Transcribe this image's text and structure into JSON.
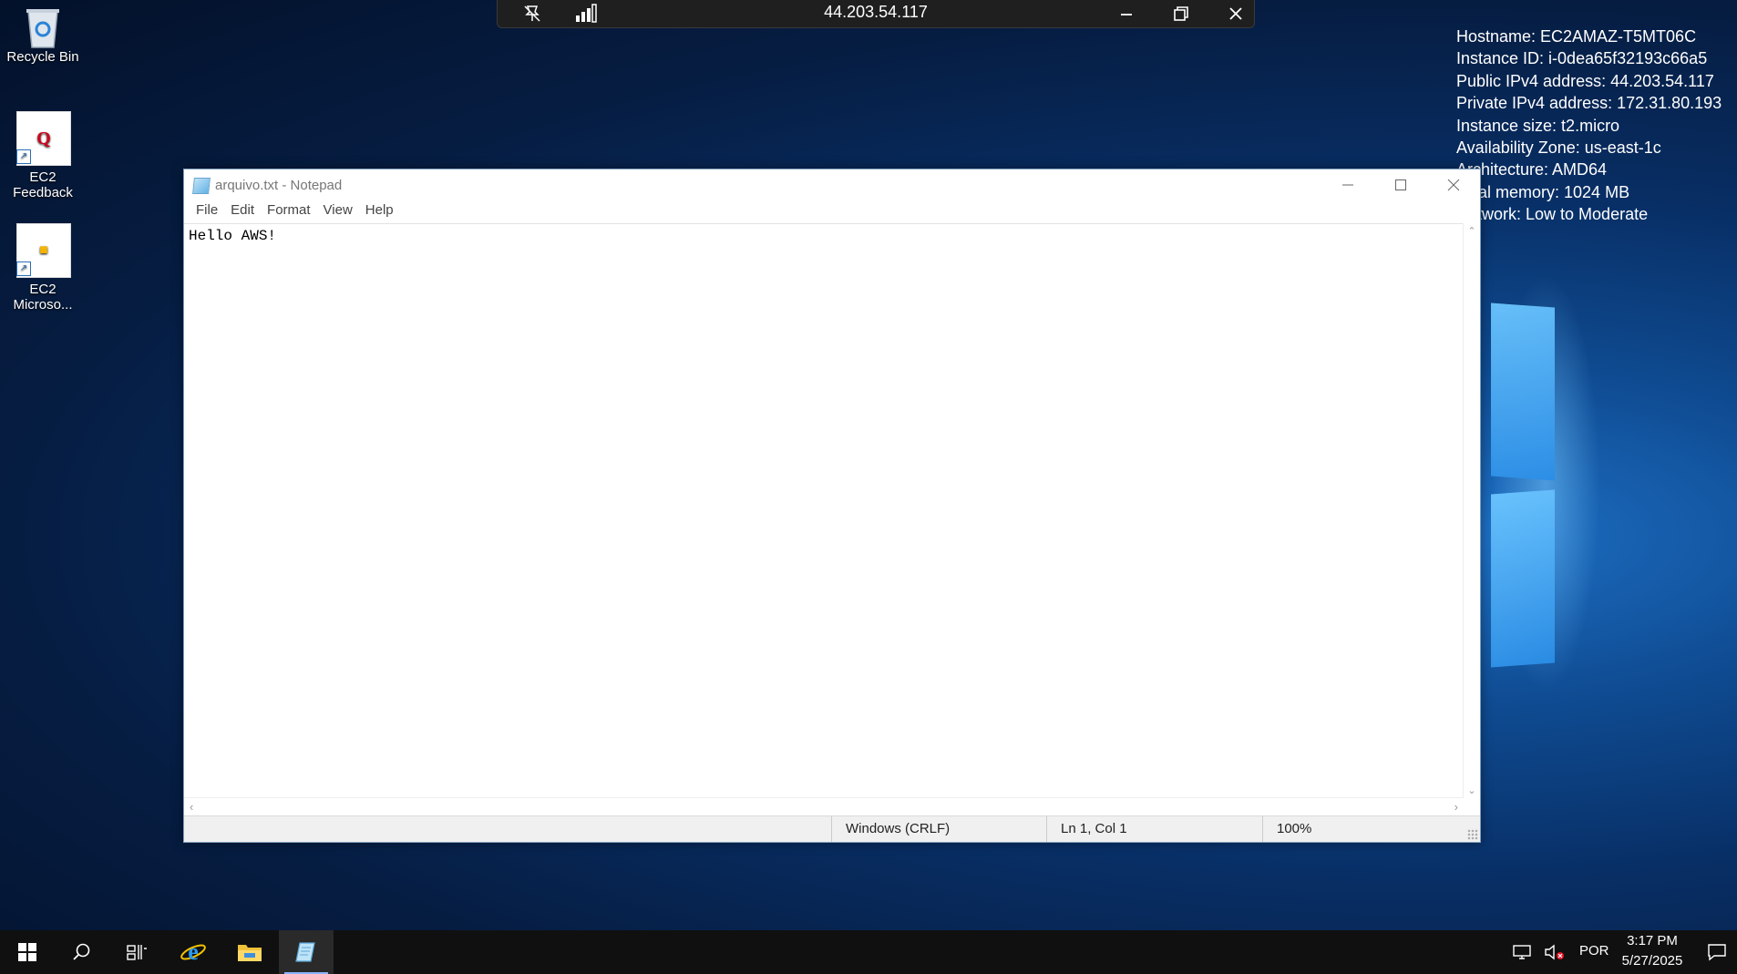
{
  "desktop": {
    "icons": [
      {
        "label": "Recycle Bin",
        "icon": "recycle-bin-icon"
      },
      {
        "label": "EC2\nFeedback",
        "icon": "ec2-feedback-icon",
        "glyph": "Q"
      },
      {
        "label": "EC2\nMicroso...",
        "icon": "ec2-microsoft-icon",
        "glyph": "■"
      }
    ]
  },
  "rdp_bar": {
    "host": "44.203.54.117",
    "pin_icon": "pin-off-icon",
    "signal_icon": "signal-bars-icon",
    "minimize_icon": "minimize-icon",
    "restore_icon": "restore-icon",
    "close_icon": "close-icon"
  },
  "bginfo": {
    "lines": [
      "Hostname: EC2AMAZ-T5MT06C",
      "Instance ID: i-0dea65f32193c66a5",
      "Public IPv4 address: 44.203.54.117",
      "Private IPv4 address: 172.31.80.193",
      "Instance size: t2.micro",
      "Availability Zone: us-east-1c",
      "Architecture: AMD64",
      "Total memory: 1024 MB",
      "Network: Low to Moderate"
    ]
  },
  "notepad": {
    "title": "arquivo.txt - Notepad",
    "menu": [
      "File",
      "Edit",
      "Format",
      "View",
      "Help"
    ],
    "content": "Hello AWS!",
    "status": {
      "encoding": "Windows (CRLF)",
      "position": "Ln 1, Col 1",
      "zoom": "100%"
    }
  },
  "taskbar": {
    "language": "POR",
    "time": "3:17 PM",
    "date": "5/27/2025",
    "accent": "#8ab4ff"
  }
}
